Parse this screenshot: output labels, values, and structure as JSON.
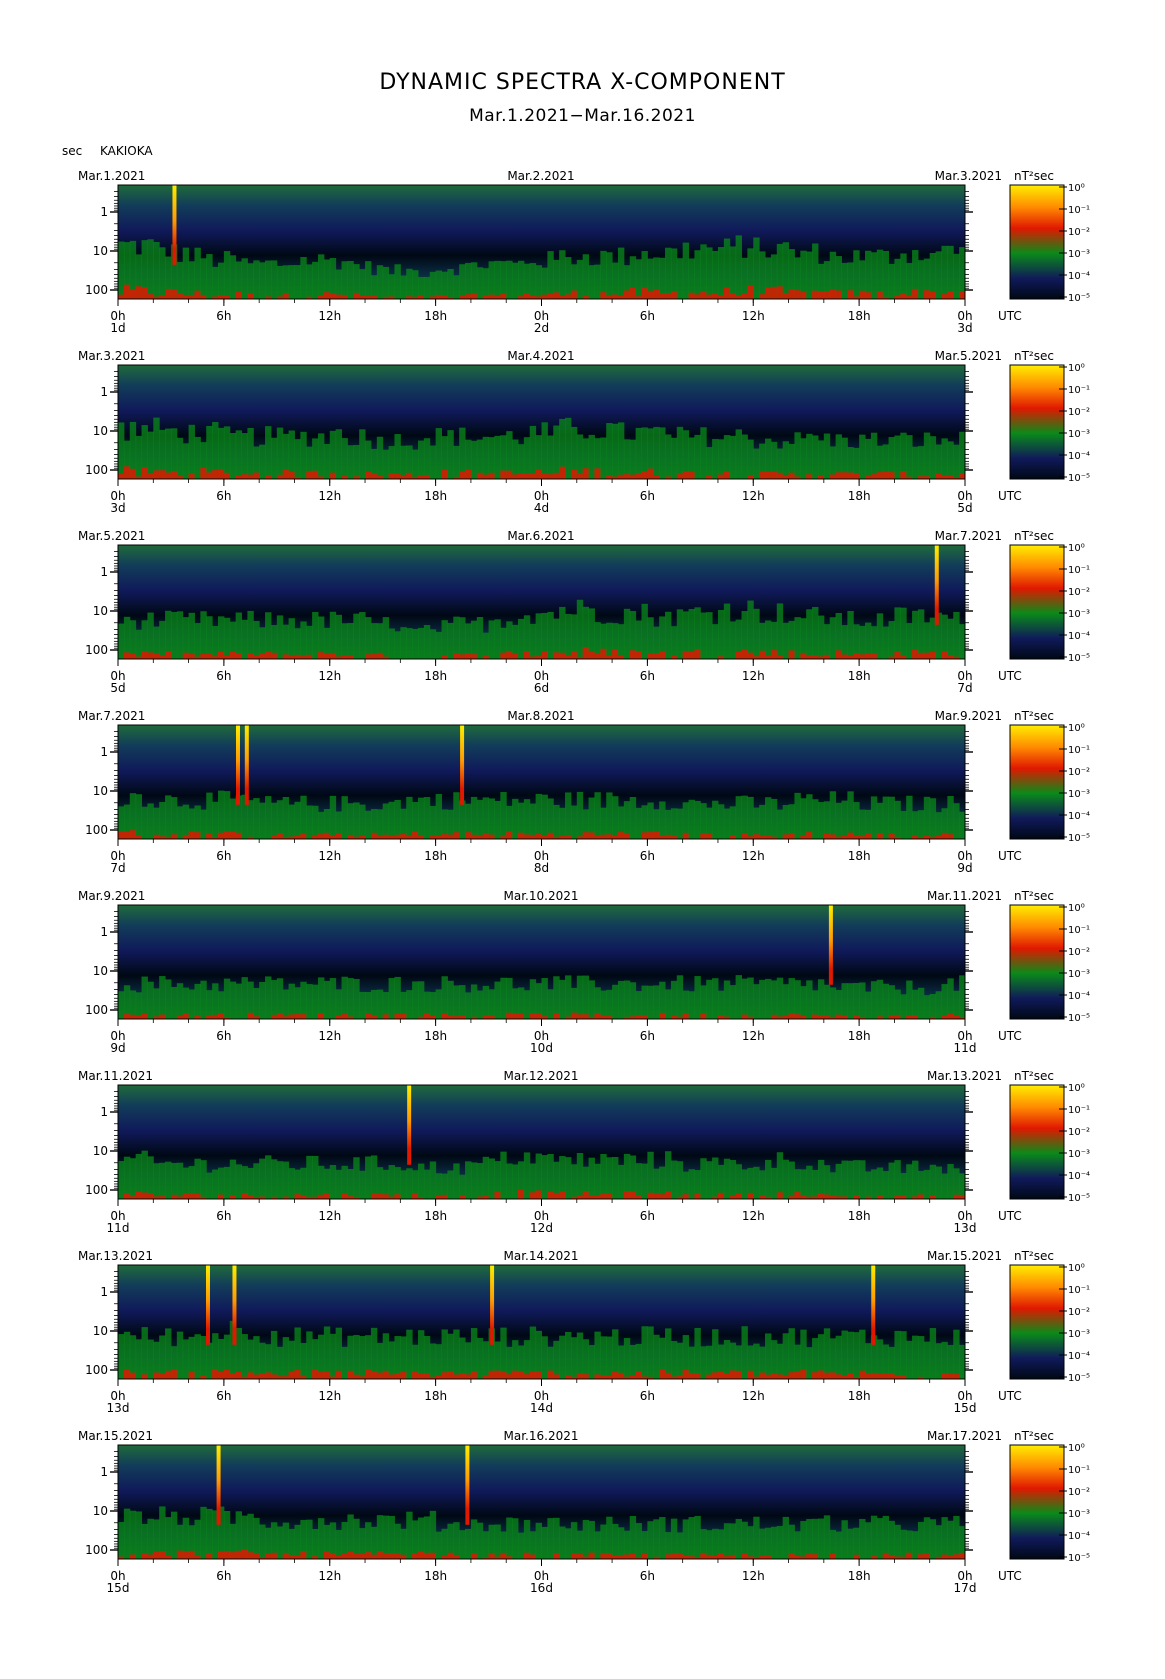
{
  "title": "DYNAMIC SPECTRA X-COMPONENT",
  "subtitle": "Mar.1.2021−Mar.16.2021",
  "unit_label": "sec",
  "station": "KAKIOKA",
  "units_label": "nT²sec",
  "colors": {
    "low": "#000814",
    "blue": "#101a5a",
    "green": "#0a8a1a",
    "red": "#e01800",
    "yellow": "#ffee00"
  },
  "chart_data": [
    {
      "type": "heatmap",
      "left_date": "Mar.1.2021",
      "center_date": "Mar.2.2021",
      "right_date": "Mar.3.2021",
      "day_labels": [
        "1d",
        "2d",
        "3d"
      ],
      "x_ticks": [
        "0h",
        "6h",
        "12h",
        "18h",
        "0h",
        "6h",
        "12h",
        "18h",
        "0h"
      ],
      "x_unit": "UTC",
      "y_ticks": [
        "1",
        "10",
        "100"
      ],
      "colorbar_ticks": [
        "10⁰",
        "10⁻¹",
        "10⁻²",
        "10⁻³",
        "10⁻⁴",
        "10⁻⁵"
      ],
      "spikes": [
        3.2
      ],
      "activity": [
        0.9,
        0.9,
        0.8,
        0.7,
        0.6,
        0.5,
        0.5,
        0.4,
        0.4,
        0.4,
        0.5,
        0.5,
        0.5,
        0.4,
        0.3,
        0.2,
        0.2,
        0.2,
        0.3,
        0.3,
        0.4,
        0.4,
        0.4,
        0.5,
        0.5,
        0.6,
        0.6,
        0.6,
        0.6,
        0.7,
        0.7,
        0.7,
        0.8,
        0.8,
        0.8,
        0.9,
        0.8,
        0.8,
        0.7,
        0.7,
        0.6,
        0.6,
        0.6,
        0.6,
        0.7,
        0.7,
        0.7,
        0.8
      ]
    },
    {
      "type": "heatmap",
      "left_date": "Mar.3.2021",
      "center_date": "Mar.4.2021",
      "right_date": "Mar.5.2021",
      "day_labels": [
        "3d",
        "4d",
        "5d"
      ],
      "x_ticks": [
        "0h",
        "6h",
        "12h",
        "18h",
        "0h",
        "6h",
        "12h",
        "18h",
        "0h"
      ],
      "x_unit": "UTC",
      "y_ticks": [
        "1",
        "10",
        "100"
      ],
      "colorbar_ticks": [
        "10⁰",
        "10⁻¹",
        "10⁻²",
        "10⁻³",
        "10⁻⁴",
        "10⁻⁵"
      ],
      "spikes": [],
      "activity": [
        0.8,
        0.8,
        0.8,
        0.7,
        0.7,
        0.7,
        0.6,
        0.6,
        0.6,
        0.6,
        0.6,
        0.6,
        0.7,
        0.6,
        0.5,
        0.5,
        0.5,
        0.6,
        0.6,
        0.6,
        0.6,
        0.6,
        0.6,
        0.7,
        0.7,
        0.8,
        0.8,
        0.8,
        0.7,
        0.7,
        0.7,
        0.6,
        0.6,
        0.6,
        0.6,
        0.6,
        0.5,
        0.5,
        0.5,
        0.6,
        0.5,
        0.5,
        0.5,
        0.5,
        0.5,
        0.5,
        0.5,
        0.5
      ]
    },
    {
      "type": "heatmap",
      "left_date": "Mar.5.2021",
      "center_date": "Mar.6.2021",
      "right_date": "Mar.7.2021",
      "day_labels": [
        "5d",
        "6d",
        "7d"
      ],
      "x_ticks": [
        "0h",
        "6h",
        "12h",
        "18h",
        "0h",
        "6h",
        "12h",
        "18h",
        "0h"
      ],
      "x_unit": "UTC",
      "y_ticks": [
        "1",
        "10",
        "100"
      ],
      "colorbar_ticks": [
        "10⁰",
        "10⁻¹",
        "10⁻²",
        "10⁻³",
        "10⁻⁴",
        "10⁻⁵"
      ],
      "spikes": [
        46.4
      ],
      "activity": [
        0.5,
        0.5,
        0.5,
        0.5,
        0.5,
        0.5,
        0.5,
        0.5,
        0.5,
        0.5,
        0.5,
        0.5,
        0.5,
        0.5,
        0.4,
        0.4,
        0.2,
        0.2,
        0.3,
        0.4,
        0.4,
        0.5,
        0.6,
        0.7,
        0.7,
        0.8,
        0.8,
        0.7,
        0.7,
        0.7,
        0.6,
        0.6,
        0.7,
        0.7,
        0.8,
        0.8,
        0.7,
        0.7,
        0.6,
        0.6,
        0.6,
        0.5,
        0.5,
        0.5,
        0.6,
        0.6,
        0.6,
        0.5
      ]
    },
    {
      "type": "heatmap",
      "left_date": "Mar.7.2021",
      "center_date": "Mar.8.2021",
      "right_date": "Mar.9.2021",
      "day_labels": [
        "7d",
        "8d",
        "9d"
      ],
      "x_ticks": [
        "0h",
        "6h",
        "12h",
        "18h",
        "0h",
        "6h",
        "12h",
        "18h",
        "0h"
      ],
      "x_unit": "UTC",
      "y_ticks": [
        "1",
        "10",
        "100"
      ],
      "colorbar_ticks": [
        "10⁰",
        "10⁻¹",
        "10⁻²",
        "10⁻³",
        "10⁻⁴",
        "10⁻⁵"
      ],
      "spikes": [
        6.8,
        7.3,
        19.5
      ],
      "activity": [
        0.6,
        0.6,
        0.5,
        0.5,
        0.5,
        0.5,
        0.5,
        0.5,
        0.4,
        0.4,
        0.4,
        0.4,
        0.4,
        0.4,
        0.4,
        0.4,
        0.5,
        0.5,
        0.5,
        0.5,
        0.5,
        0.5,
        0.5,
        0.5,
        0.5,
        0.5,
        0.5,
        0.5,
        0.5,
        0.5,
        0.5,
        0.5,
        0.4,
        0.4,
        0.4,
        0.4,
        0.4,
        0.4,
        0.5,
        0.5,
        0.5,
        0.5,
        0.4,
        0.4,
        0.4,
        0.4,
        0.4,
        0.4
      ]
    },
    {
      "type": "heatmap",
      "left_date": "Mar.9.2021",
      "center_date": "Mar.10.2021",
      "right_date": "Mar.11.2021",
      "day_labels": [
        "9d",
        "10d",
        "11d"
      ],
      "x_ticks": [
        "0h",
        "6h",
        "12h",
        "18h",
        "0h",
        "6h",
        "12h",
        "18h",
        "0h"
      ],
      "x_unit": "UTC",
      "y_ticks": [
        "1",
        "10",
        "100"
      ],
      "colorbar_ticks": [
        "10⁰",
        "10⁻¹",
        "10⁻²",
        "10⁻³",
        "10⁻⁴",
        "10⁻⁵"
      ],
      "spikes": [
        40.4
      ],
      "activity": [
        0.4,
        0.4,
        0.4,
        0.4,
        0.4,
        0.4,
        0.4,
        0.4,
        0.4,
        0.4,
        0.4,
        0.4,
        0.4,
        0.4,
        0.4,
        0.4,
        0.4,
        0.4,
        0.4,
        0.4,
        0.4,
        0.4,
        0.4,
        0.4,
        0.4,
        0.4,
        0.4,
        0.4,
        0.4,
        0.4,
        0.4,
        0.4,
        0.4,
        0.4,
        0.4,
        0.4,
        0.4,
        0.4,
        0.4,
        0.4,
        0.3,
        0.3,
        0.3,
        0.3,
        0.3,
        0.3,
        0.3,
        0.4
      ]
    },
    {
      "type": "heatmap",
      "left_date": "Mar.11.2021",
      "center_date": "Mar.12.2021",
      "right_date": "Mar.13.2021",
      "day_labels": [
        "11d",
        "12d",
        "13d"
      ],
      "x_ticks": [
        "0h",
        "6h",
        "12h",
        "18h",
        "0h",
        "6h",
        "12h",
        "18h",
        "0h"
      ],
      "x_unit": "UTC",
      "y_ticks": [
        "1",
        "10",
        "100"
      ],
      "colorbar_ticks": [
        "10⁰",
        "10⁻¹",
        "10⁻²",
        "10⁻³",
        "10⁻⁴",
        "10⁻⁵"
      ],
      "spikes": [
        16.5
      ],
      "activity": [
        0.5,
        0.5,
        0.4,
        0.4,
        0.4,
        0.4,
        0.4,
        0.4,
        0.4,
        0.4,
        0.4,
        0.4,
        0.4,
        0.4,
        0.4,
        0.4,
        0.4,
        0.3,
        0.3,
        0.3,
        0.4,
        0.5,
        0.6,
        0.6,
        0.5,
        0.5,
        0.5,
        0.5,
        0.5,
        0.5,
        0.5,
        0.5,
        0.4,
        0.4,
        0.4,
        0.4,
        0.4,
        0.5,
        0.5,
        0.4,
        0.3,
        0.3,
        0.3,
        0.3,
        0.3,
        0.3,
        0.3,
        0.3
      ]
    },
    {
      "type": "heatmap",
      "left_date": "Mar.13.2021",
      "center_date": "Mar.14.2021",
      "right_date": "Mar.15.2021",
      "day_labels": [
        "13d",
        "14d",
        "15d"
      ],
      "x_ticks": [
        "0h",
        "6h",
        "12h",
        "18h",
        "0h",
        "6h",
        "12h",
        "18h",
        "0h"
      ],
      "x_unit": "UTC",
      "y_ticks": [
        "1",
        "10",
        "100"
      ],
      "colorbar_ticks": [
        "10⁰",
        "10⁻¹",
        "10⁻²",
        "10⁻³",
        "10⁻⁴",
        "10⁻⁵"
      ],
      "spikes": [
        5.1,
        6.6,
        21.2,
        42.8
      ],
      "activity": [
        0.6,
        0.6,
        0.6,
        0.6,
        0.6,
        0.7,
        0.8,
        0.8,
        0.7,
        0.6,
        0.6,
        0.6,
        0.6,
        0.6,
        0.6,
        0.6,
        0.6,
        0.6,
        0.6,
        0.6,
        0.6,
        0.6,
        0.6,
        0.6,
        0.6,
        0.6,
        0.6,
        0.6,
        0.6,
        0.6,
        0.6,
        0.6,
        0.6,
        0.6,
        0.6,
        0.6,
        0.6,
        0.6,
        0.6,
        0.6,
        0.6,
        0.6,
        0.6,
        0.6,
        0.6,
        0.6,
        0.6,
        0.6
      ]
    },
    {
      "type": "heatmap",
      "left_date": "Mar.15.2021",
      "center_date": "Mar.16.2021",
      "right_date": "Mar.17.2021",
      "day_labels": [
        "15d",
        "16d",
        "17d"
      ],
      "x_ticks": [
        "0h",
        "6h",
        "12h",
        "18h",
        "0h",
        "6h",
        "12h",
        "18h",
        "0h"
      ],
      "x_unit": "UTC",
      "y_ticks": [
        "1",
        "10",
        "100"
      ],
      "colorbar_ticks": [
        "10⁰",
        "10⁻¹",
        "10⁻²",
        "10⁻³",
        "10⁻⁴",
        "10⁻⁵"
      ],
      "spikes": [
        5.7,
        19.8
      ],
      "activity": [
        0.6,
        0.6,
        0.6,
        0.6,
        0.6,
        0.6,
        0.6,
        0.6,
        0.5,
        0.5,
        0.5,
        0.5,
        0.5,
        0.5,
        0.5,
        0.5,
        0.5,
        0.5,
        0.4,
        0.4,
        0.4,
        0.4,
        0.4,
        0.4,
        0.4,
        0.4,
        0.4,
        0.4,
        0.4,
        0.4,
        0.4,
        0.4,
        0.4,
        0.4,
        0.4,
        0.4,
        0.4,
        0.4,
        0.4,
        0.4,
        0.4,
        0.4,
        0.4,
        0.4,
        0.4,
        0.4,
        0.4,
        0.4
      ]
    }
  ]
}
